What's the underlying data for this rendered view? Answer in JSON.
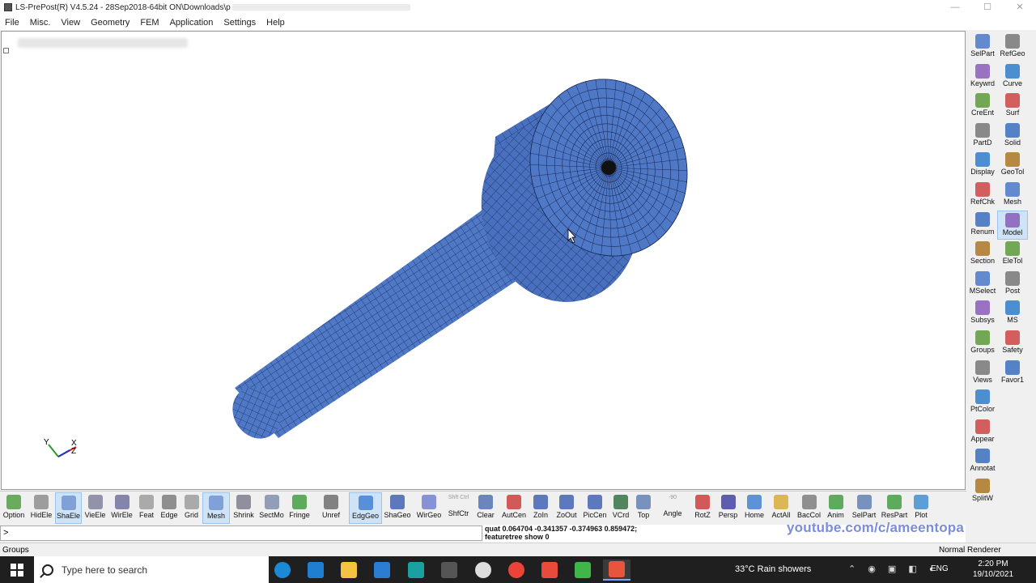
{
  "window": {
    "title": "LS-PrePost(R) V4.5.24 - 28Sep2018-64bit ON\\Downloads\\p",
    "minimize": "—",
    "maximize": "☐",
    "close": "✕"
  },
  "menu": [
    "File",
    "Misc.",
    "View",
    "Geometry",
    "FEM",
    "Application",
    "Settings",
    "Help"
  ],
  "right_panel": {
    "left_column": [
      {
        "label": "SelPart",
        "icon": "selpart-icon"
      },
      {
        "label": "Keywrd",
        "icon": "keyword-icon"
      },
      {
        "label": "CreEnt",
        "icon": "create-entity-icon"
      },
      {
        "label": "PartD",
        "icon": "part-data-icon"
      },
      {
        "label": "Display",
        "icon": "display-icon"
      },
      {
        "label": "RefChk",
        "icon": "reference-check-icon"
      },
      {
        "label": "Renum",
        "icon": "renumber-icon"
      },
      {
        "label": "Section",
        "icon": "section-icon"
      },
      {
        "label": "MSelect",
        "icon": "multi-select-icon"
      },
      {
        "label": "Subsys",
        "icon": "subsystem-icon"
      },
      {
        "label": "Groups",
        "icon": "groups-icon"
      },
      {
        "label": "Views",
        "icon": "views-icon"
      },
      {
        "label": "PtColor",
        "icon": "part-color-icon"
      },
      {
        "label": "Appear",
        "icon": "appearance-icon"
      },
      {
        "label": "Annotat",
        "icon": "annotation-icon"
      },
      {
        "label": "SplitW",
        "icon": "split-window-icon"
      }
    ],
    "right_column": [
      {
        "label": "RefGeo",
        "icon": "reference-geometry-icon"
      },
      {
        "label": "Curve",
        "icon": "curve-icon"
      },
      {
        "label": "Surf",
        "icon": "surface-icon"
      },
      {
        "label": "Solid",
        "icon": "solid-icon"
      },
      {
        "label": "GeoTol",
        "icon": "geometry-tolerance-icon"
      },
      {
        "label": "Mesh",
        "icon": "mesh-icon"
      },
      {
        "label": "Model",
        "icon": "model-icon",
        "selected": true
      },
      {
        "label": "EleTol",
        "icon": "element-tool-icon"
      },
      {
        "label": "Post",
        "icon": "post-icon"
      },
      {
        "label": "MS",
        "icon": "ms-icon"
      },
      {
        "label": "Safety",
        "icon": "safety-icon"
      },
      {
        "label": "Favor1",
        "icon": "favorite-icon"
      }
    ],
    "renum_small": "Renum"
  },
  "bottom_toolbar": [
    {
      "label": "Option",
      "icon": "option-icon"
    },
    {
      "label": "HidEle",
      "icon": "hidden-element-icon"
    },
    {
      "label": "ShaEle",
      "icon": "shaded-element-icon",
      "selected": true
    },
    {
      "label": "VieEle",
      "icon": "view-element-icon"
    },
    {
      "label": "WirEle",
      "icon": "wire-element-icon"
    },
    {
      "label": "Feat",
      "icon": "feature-icon"
    },
    {
      "label": "Edge",
      "icon": "edge-icon"
    },
    {
      "label": "Grid",
      "icon": "grid-icon"
    },
    {
      "label": "Mesh",
      "icon": "mesh-view-icon",
      "selected": true
    },
    {
      "label": "Shrink",
      "icon": "shrink-icon"
    },
    {
      "label": "SectMo",
      "icon": "section-mode-icon"
    },
    {
      "label": "Fringe",
      "icon": "fringe-icon"
    },
    {
      "label": "Unref",
      "icon": "unreferenced-icon"
    },
    {
      "label": "EdgGeo",
      "icon": "edge-geometry-icon",
      "selected": true
    },
    {
      "label": "ShaGeo",
      "icon": "shaded-geometry-icon"
    },
    {
      "label": "WirGeo",
      "icon": "wire-geometry-icon"
    },
    {
      "label": "ShfCtr",
      "icon": "shift-ctrl-icon",
      "sublabel": "Shft Ctrl"
    },
    {
      "label": "Clear",
      "icon": "clear-icon"
    },
    {
      "label": "AutCen",
      "icon": "auto-center-icon"
    },
    {
      "label": "ZoIn",
      "icon": "zoom-in-icon"
    },
    {
      "label": "ZoOut",
      "icon": "zoom-out-icon"
    },
    {
      "label": "PicCen",
      "icon": "pick-center-icon"
    },
    {
      "label": "VCrd",
      "icon": "view-coordinate-icon"
    },
    {
      "label": "Top",
      "icon": "top-view-icon"
    },
    {
      "label": "Angle",
      "icon": "angle-icon",
      "sublabel": "-90"
    },
    {
      "label": "RotZ",
      "icon": "rotate-z-icon"
    },
    {
      "label": "Persp",
      "icon": "perspective-icon"
    },
    {
      "label": "Home",
      "icon": "home-icon"
    },
    {
      "label": "ActAll",
      "icon": "activate-all-icon"
    },
    {
      "label": "BacCol",
      "icon": "background-color-icon"
    },
    {
      "label": "Anim",
      "icon": "animate-icon"
    },
    {
      "label": "SelPart",
      "icon": "select-part-icon"
    },
    {
      "label": "ResPart",
      "icon": "reset-part-icon"
    },
    {
      "label": "Plot",
      "icon": "plot-icon"
    }
  ],
  "command": {
    "prompt": ">",
    "output_line1": "quat 0.064704 -0.341357 -0.374963 0.859472;",
    "output_line2": "featuretree show 0"
  },
  "watermark": "youtube.com/c/ameentopa",
  "status": {
    "left": "Groups",
    "right": "Normal Renderer"
  },
  "taskbar": {
    "search_placeholder": "Type here to search",
    "weather": "33°C  Rain showers",
    "language": "ENG",
    "time": "2:20 PM",
    "date": "19/10/2021"
  },
  "triad": {
    "x": "X",
    "y": "Y",
    "z": "Z"
  },
  "colors": {
    "mesh_blue": "#4f78c6",
    "mesh_line": "#1b2b57",
    "selected_bg": "#cfe3f7",
    "watermark": "#7a8cdc"
  }
}
